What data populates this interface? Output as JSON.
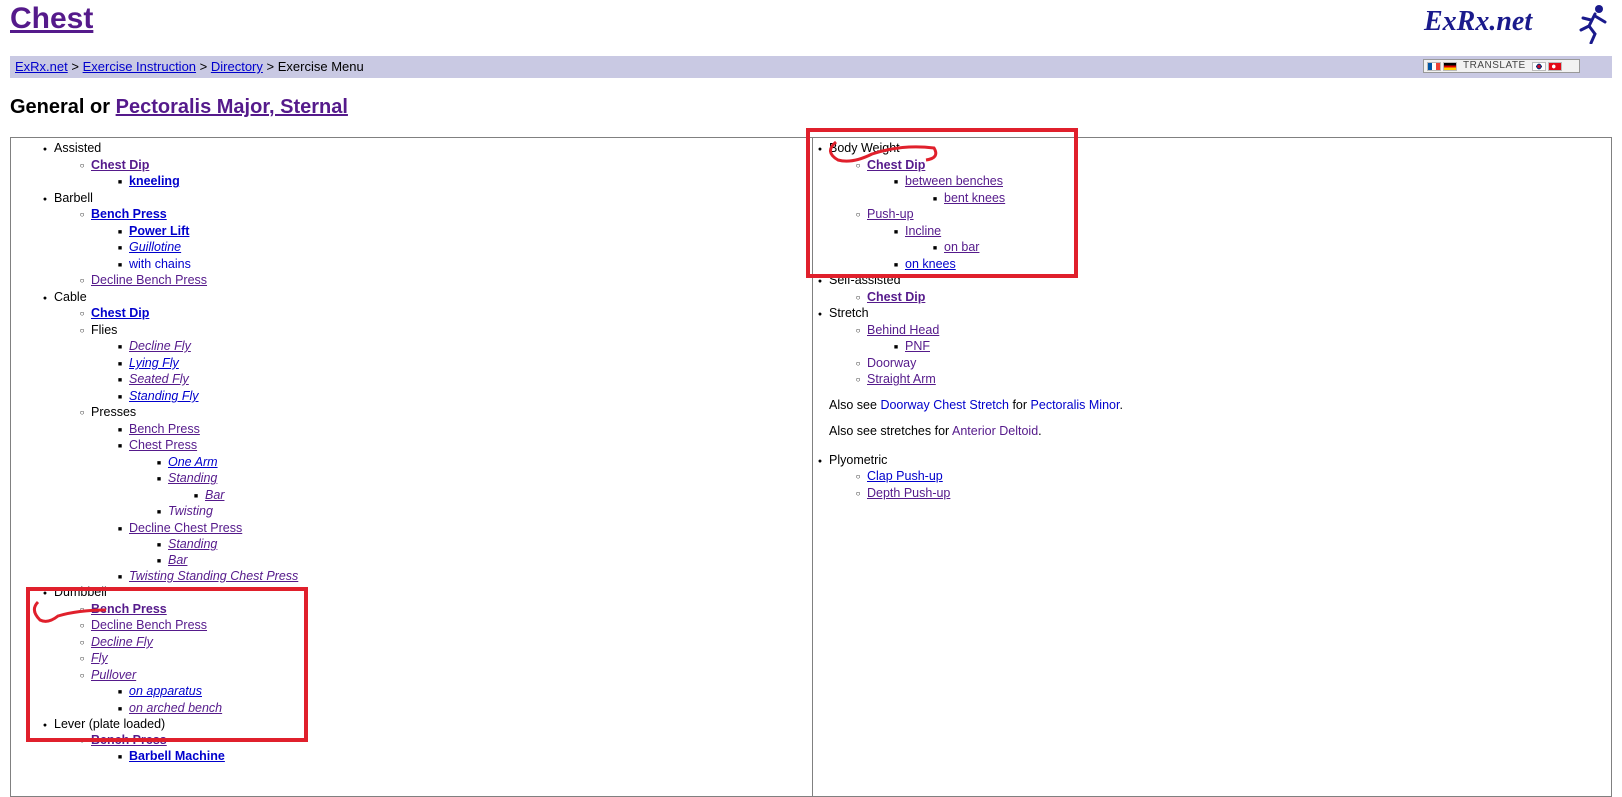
{
  "page_title": "Chest",
  "logo_text": "ExRx.net",
  "breadcrumb": {
    "items": [
      "ExRx.net",
      "Exercise Instruction",
      "Directory"
    ],
    "separator": ">",
    "current": "Exercise Menu"
  },
  "translate_label": "TRANSLATE",
  "section_heading": {
    "prefix": "General or",
    "link": "Pectoralis Major, Sternal"
  },
  "left_column": {
    "assisted": "Assisted",
    "assisted_chest_dip": "Chest Dip",
    "assisted_kneeling": "kneeling",
    "barbell": "Barbell",
    "barbell_bench_press": "Bench Press",
    "barbell_power_lift": "Power Lift",
    "barbell_guillotine": "Guillotine",
    "barbell_with_chains": "with chains",
    "barbell_decline_bench": "Decline Bench Press",
    "cable": "Cable",
    "cable_chest_dip": "Chest Dip",
    "cable_flies": "Flies",
    "fly_decline": "Decline Fly",
    "fly_lying": "Lying Fly",
    "fly_seated": "Seated Fly",
    "fly_standing": "Standing Fly",
    "cable_presses": "Presses",
    "press_bench": "Bench Press",
    "press_chest": "Chest Press",
    "press_one_arm": "One Arm",
    "press_standing": "Standing",
    "press_bar": "Bar",
    "press_twisting": "Twisting",
    "press_decline_chest": "Decline Chest Press",
    "decline_standing": "Standing",
    "decline_bar": "Bar",
    "press_twisting_standing": "Twisting Standing Chest Press",
    "dumbbell": "Dumbbell",
    "db_bench_press": "Bench Press",
    "db_decline_bench": "Decline Bench Press",
    "db_decline_fly": "Decline Fly",
    "db_fly": "Fly",
    "db_pullover": "Pullover",
    "db_on_apparatus": "on apparatus",
    "db_on_arched_bench": "on arched bench",
    "lever": "Lever (plate loaded)",
    "lever_bench_press": "Bench Press",
    "lever_barbell_machine": "Barbell Machine"
  },
  "right_column": {
    "body_weight": "Body Weight",
    "bw_chest_dip": "Chest Dip",
    "bw_between_benches": "between benches",
    "bw_bent_knees": "bent knees",
    "bw_push_up": "Push-up",
    "bw_incline": "Incline",
    "bw_on_bar": "on bar",
    "bw_on_knees": "on knees",
    "self_assisted": "Self-assisted",
    "sa_chest_dip": "Chest Dip",
    "stretch": "Stretch",
    "st_behind_head": "Behind Head",
    "st_pnf": "PNF",
    "st_doorway": "Doorway",
    "st_straight_arm": "Straight Arm",
    "note1_prefix": "Also see",
    "note1_link": "Doorway Chest Stretch",
    "note1_mid": "for",
    "note1_link2": "Pectoralis Minor",
    "note1_suffix": ".",
    "note2_prefix": "Also see stretches for",
    "note2_link": "Anterior Deltoid",
    "note2_suffix": ".",
    "plyometric": "Plyometric",
    "ply_clap": "Clap Push-up",
    "ply_depth": "Depth Push-up"
  },
  "colors": {
    "highlight": "#e0202c",
    "breadcrumb_bg": "#c9c9e3",
    "link_visited": "#551a8b",
    "link": "#0000cc"
  }
}
